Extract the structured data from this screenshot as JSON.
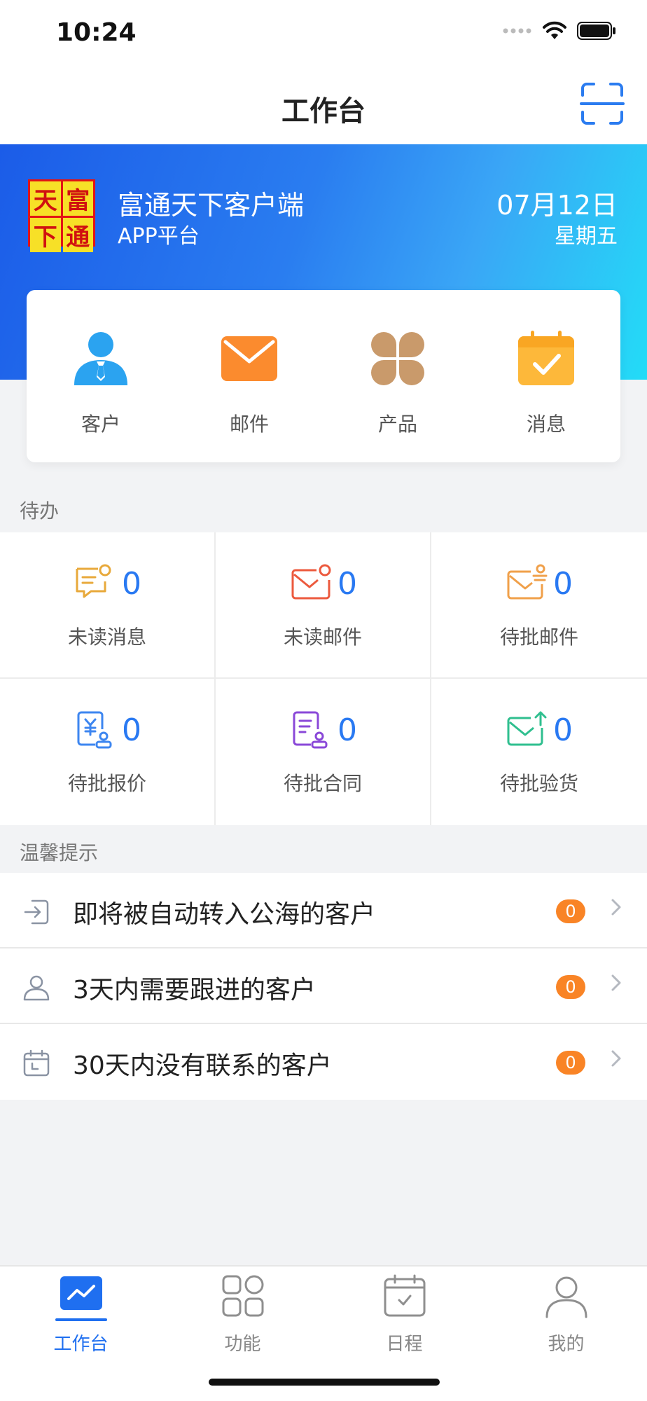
{
  "status_bar": {
    "time": "10:24"
  },
  "nav": {
    "title": "工作台"
  },
  "banner": {
    "logo_chars": [
      "天",
      "富",
      "下",
      "通"
    ],
    "company_name": "富通天下客户端",
    "company_sub": "APP平台",
    "date": "07月12日",
    "weekday": "星期五"
  },
  "quick_actions": [
    {
      "label": "客户",
      "icon": "customer-icon"
    },
    {
      "label": "邮件",
      "icon": "mail-icon"
    },
    {
      "label": "产品",
      "icon": "product-icon"
    },
    {
      "label": "消息",
      "icon": "message-icon"
    }
  ],
  "todo": {
    "title": "待办",
    "items": [
      {
        "label": "未读消息",
        "count": "0",
        "icon": "unread-message-icon",
        "color": "#e8a93b"
      },
      {
        "label": "未读邮件",
        "count": "0",
        "icon": "unread-mail-icon",
        "color": "#ec5a3e"
      },
      {
        "label": "待批邮件",
        "count": "0",
        "icon": "pending-mail-icon",
        "color": "#f0a04a"
      },
      {
        "label": "待批报价",
        "count": "0",
        "icon": "pending-quote-icon",
        "color": "#3d86f0"
      },
      {
        "label": "待批合同",
        "count": "0",
        "icon": "pending-contract-icon",
        "color": "#8a48d8"
      },
      {
        "label": "待批验货",
        "count": "0",
        "icon": "pending-inspection-icon",
        "color": "#2fbf8f"
      }
    ]
  },
  "tips": {
    "title": "温馨提示",
    "items": [
      {
        "text": "即将被自动转入公海的客户",
        "badge": "0",
        "icon": "transfer-icon"
      },
      {
        "text": "3天内需要跟进的客户",
        "badge": "0",
        "icon": "person-icon"
      },
      {
        "text": "30天内没有联系的客户",
        "badge": "0",
        "icon": "calendar-icon"
      }
    ]
  },
  "tab_bar": [
    {
      "label": "工作台",
      "active": true
    },
    {
      "label": "功能",
      "active": false
    },
    {
      "label": "日程",
      "active": false
    },
    {
      "label": "我的",
      "active": false
    }
  ],
  "colors": {
    "accent": "#1f6ff0",
    "badge": "#f98426",
    "count": "#2979f2"
  }
}
